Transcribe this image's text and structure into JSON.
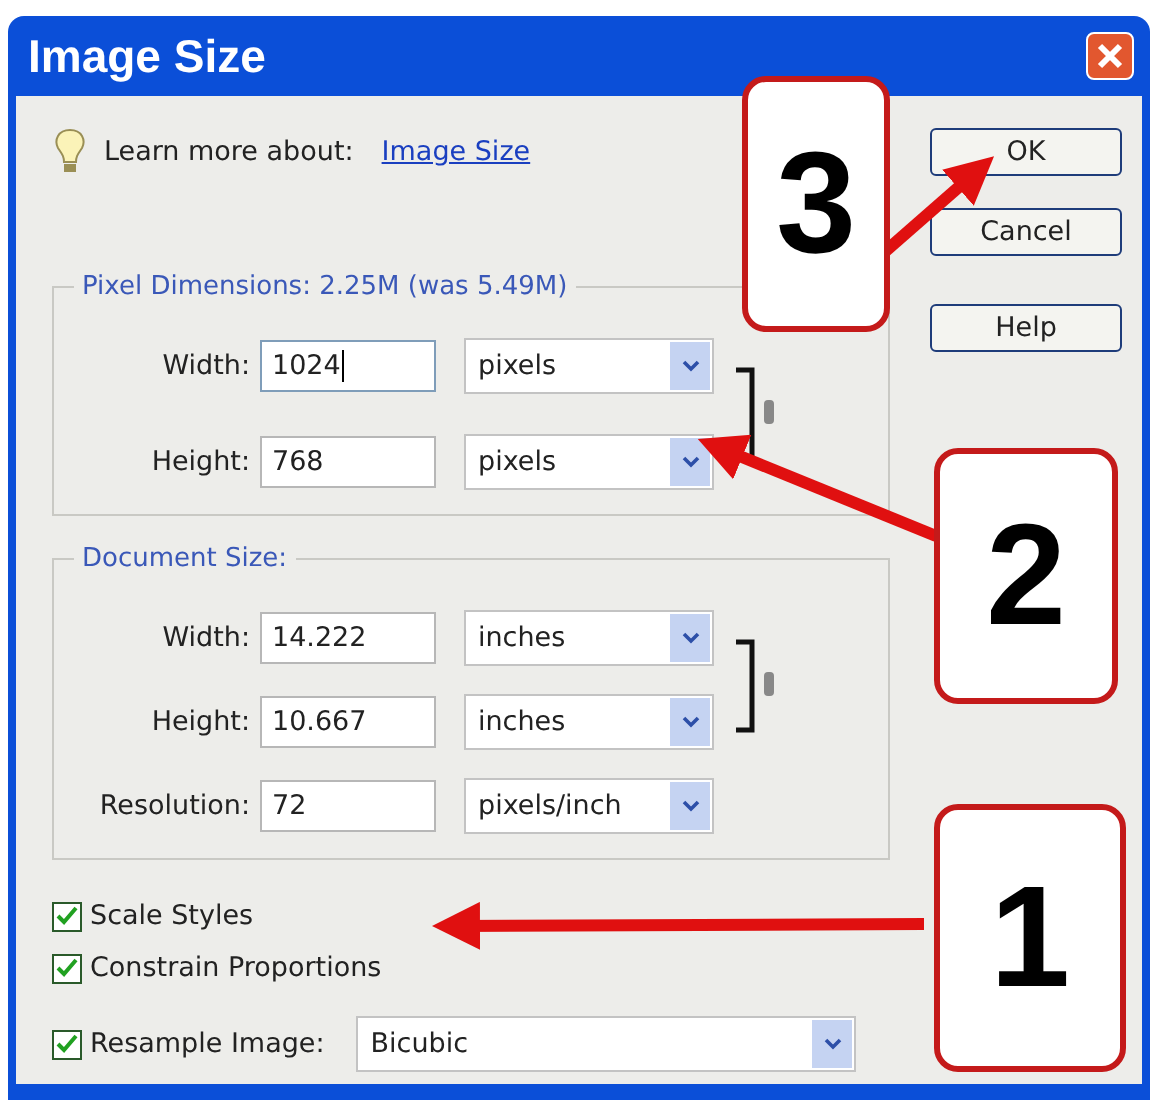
{
  "window": {
    "title": "Image Size"
  },
  "learn_more": {
    "label": "Learn more about:",
    "link": "Image Size"
  },
  "pixel_dimensions": {
    "legend": "Pixel Dimensions:  2.25M (was 5.49M)",
    "rows": [
      {
        "label": "Width:",
        "value": "1024",
        "unit": "pixels",
        "focused": true
      },
      {
        "label": "Height:",
        "value": "768",
        "unit": "pixels",
        "focused": false
      }
    ]
  },
  "document_size": {
    "legend": "Document Size:",
    "rows": [
      {
        "label": "Width:",
        "value": "14.222",
        "unit": "inches"
      },
      {
        "label": "Height:",
        "value": "10.667",
        "unit": "inches"
      },
      {
        "label": "Resolution:",
        "value": "72",
        "unit": "pixels/inch"
      }
    ]
  },
  "options": [
    {
      "label": "Scale Styles",
      "checked": true
    },
    {
      "label": "Constrain Proportions",
      "checked": true
    }
  ],
  "resample": {
    "label": "Resample Image:",
    "checked": true,
    "value": "Bicubic"
  },
  "buttons": [
    "OK",
    "Cancel",
    "Help"
  ],
  "callouts": [
    {
      "number": "3"
    },
    {
      "number": "2"
    },
    {
      "number": "1"
    }
  ]
}
